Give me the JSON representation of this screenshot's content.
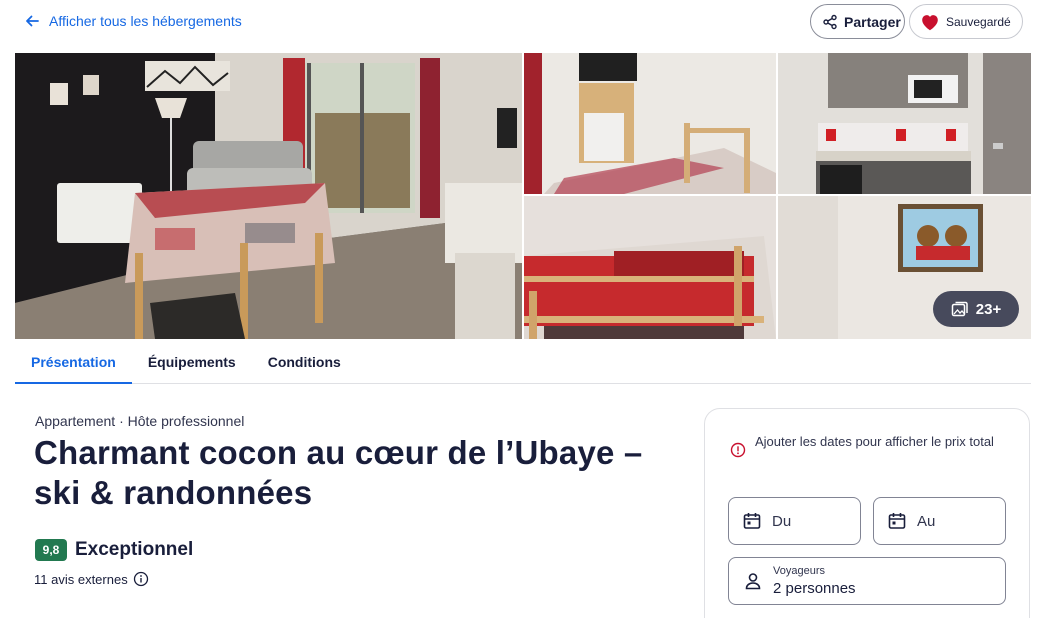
{
  "header": {
    "back_label": "Afficher tous les hébergements",
    "share_label": "Partager",
    "saved_label": "Sauvegardé"
  },
  "gallery": {
    "photo_count": "23+"
  },
  "tabs": [
    {
      "label": "Présentation",
      "active": true
    },
    {
      "label": "Équipements",
      "active": false
    },
    {
      "label": "Conditions",
      "active": false
    }
  ],
  "property": {
    "type": "Appartement",
    "host": "Hôte professionnel",
    "title": "Charmant cocon au cœur de l’Ubaye – ski & randonnées",
    "score": "9,8",
    "rating_label": "Exceptionnel",
    "reviews": "11 avis externes"
  },
  "booking": {
    "notice": "Ajouter les dates pour afficher le prix total",
    "from_placeholder": "Du",
    "to_placeholder": "Au",
    "travellers_label": "Voyageurs",
    "travellers_value": "2 personnes"
  },
  "colors": {
    "link": "#1668e3",
    "text": "#191e3b",
    "score_bg": "#227950",
    "heart": "#c8102e",
    "notice_icon": "#c8102e"
  }
}
